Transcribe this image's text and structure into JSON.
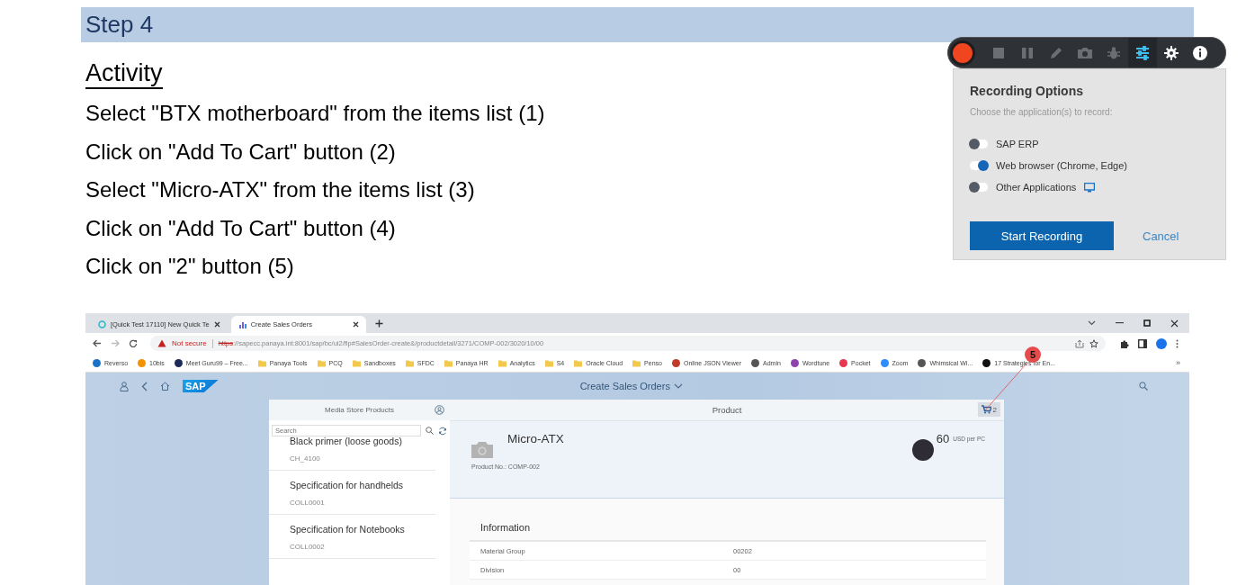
{
  "step": {
    "title": "Step 4"
  },
  "activity": {
    "heading": "Activity",
    "lines": [
      "Select \"BTX motherboard\" from the items list (1)",
      "Click on \"Add To Cart\" button (2)",
      "Select \"Micro-ATX\" from the items list (3)",
      "Click on \"Add To Cart\" button (4)",
      "Click on \"2\" button (5)"
    ]
  },
  "recorder": {
    "tools": [
      {
        "kind": "record",
        "selected": false,
        "disabled": false
      },
      {
        "kind": "stop",
        "selected": false,
        "disabled": true
      },
      {
        "kind": "pause",
        "selected": false,
        "disabled": true
      },
      {
        "kind": "pen",
        "selected": false,
        "disabled": true
      },
      {
        "kind": "camera",
        "selected": false,
        "disabled": true
      },
      {
        "kind": "bug",
        "selected": false,
        "disabled": true
      },
      {
        "kind": "sliders",
        "selected": true,
        "disabled": false
      },
      {
        "kind": "gear",
        "selected": false,
        "disabled": false
      },
      {
        "kind": "info",
        "selected": false,
        "disabled": false
      }
    ],
    "title": "Recording Options",
    "subtitle": "Choose the application(s) to record:",
    "options": [
      {
        "label": "SAP ERP",
        "on": false,
        "kind": "plain"
      },
      {
        "label": "Web browser (Chrome, Edge)",
        "on": true,
        "kind": "plain"
      },
      {
        "label": "Other Applications",
        "on": false,
        "kind": "device"
      }
    ],
    "buttons": {
      "primary": "Start Recording",
      "secondary": "Cancel"
    }
  },
  "browser": {
    "tabs": [
      {
        "title": "[Quick Test 17110] New Quick Te",
        "selected": false,
        "kind": "ring"
      },
      {
        "title": "Create Sales Orders",
        "selected": true,
        "kind": "chart"
      }
    ],
    "address": {
      "warning": "Not secure",
      "scheme": "https",
      "rest": "://sapecc.panaya.int:8001/sap/bc/ui2/flp#SalesOrder-create&/productdetail/3271/COMP-002/3020/10/00"
    },
    "bookmarks": [
      {
        "label": "Reverso",
        "kind": "site",
        "color": "#1a73c9"
      },
      {
        "label": "10bis",
        "kind": "site",
        "color": "#f39200"
      },
      {
        "label": "Meet Guru99 – Free...",
        "kind": "site",
        "color": "#1e2a5a"
      },
      {
        "label": "Panaya Tools",
        "kind": "folder"
      },
      {
        "label": "PCQ",
        "kind": "folder"
      },
      {
        "label": "Sandboxes",
        "kind": "folder"
      },
      {
        "label": "SFDC",
        "kind": "folder"
      },
      {
        "label": "Panaya HR",
        "kind": "folder"
      },
      {
        "label": "Analytics",
        "kind": "folder"
      },
      {
        "label": "S4",
        "kind": "folder"
      },
      {
        "label": "Oracle Cloud",
        "kind": "folder"
      },
      {
        "label": "Penso",
        "kind": "folder"
      },
      {
        "label": "Online JSON Viewer",
        "kind": "site",
        "color": "#c0392b"
      },
      {
        "label": "Admin",
        "kind": "site",
        "color": "#555555"
      },
      {
        "label": "Wordtune",
        "kind": "site",
        "color": "#8e44ad"
      },
      {
        "label": "Pocket",
        "kind": "site",
        "color": "#e8384f"
      },
      {
        "label": "Zoom",
        "kind": "site",
        "color": "#2d8cff"
      },
      {
        "label": "Whimsical Wi...",
        "kind": "site",
        "color": "#555555"
      },
      {
        "label": "17 Strategies for En...",
        "kind": "site",
        "color": "#111111"
      }
    ],
    "more": "»"
  },
  "app": {
    "logo": "SAP",
    "title": "Create Sales Orders",
    "master": {
      "title": "Media Store Products",
      "search_placeholder": "Search",
      "items": [
        {
          "title": "Black primer (loose goods)",
          "code": "CH_4100"
        },
        {
          "title": "Specification for handhelds",
          "code": "COLL0001"
        },
        {
          "title": "Specification for Notebooks",
          "code": "COLL0002"
        }
      ]
    },
    "detail": {
      "title": "Product",
      "cart_count": "2",
      "name": "Micro-ATX",
      "product_no": "Product No.: COMP-002",
      "price": "60",
      "unit": "USD per PC",
      "section": "Information",
      "fields": [
        {
          "label": "Material Group",
          "value": "00202"
        },
        {
          "label": "Division",
          "value": "00"
        }
      ]
    }
  },
  "callout": {
    "number": "5"
  }
}
